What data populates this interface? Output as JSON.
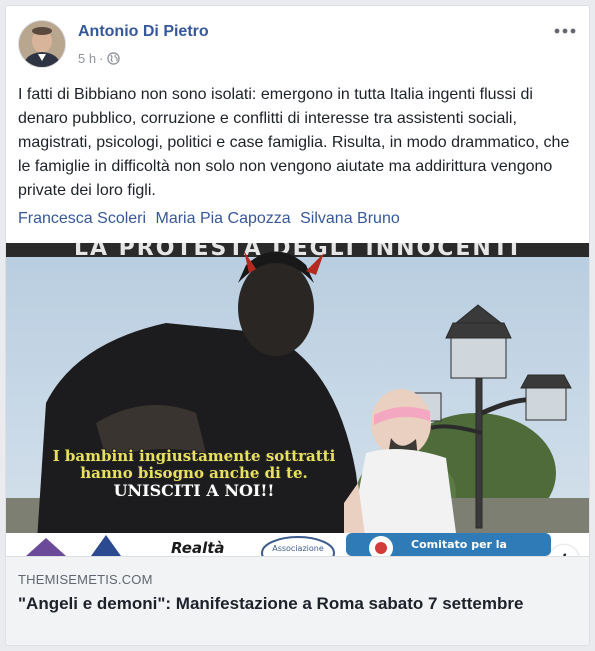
{
  "post": {
    "author": "Antonio Di Pietro",
    "time": "5 h",
    "privacy_icon": "globe-icon",
    "more_icon": "more-options-icon",
    "text": "I fatti di Bibbiano non sono isolati: emergono in tutta Italia ingenti flussi di denaro pubblico, corruzione e conflitti di interesse tra assistenti sociali, magistrati, psicologi, politici e case famiglia. Risulta, in modo drammatico, che le famiglie in difficoltà non solo non vengono aiutate ma addirittura vengono private dei loro figli.",
    "tags": [
      "Francesca Scoleri",
      "Maria Pia Capozza",
      "Silvana Bruno"
    ]
  },
  "image": {
    "banner_top": "LA PROTESTA DEGLI INNOCENTI",
    "caption_line1": "I bambini ingiustamente sottratti",
    "caption_line2": "hanno bisogno anche di te.",
    "caption_line3": "UNISCITI A NOI!!",
    "logo_text_1": "Realtà",
    "logo_text_2": "Associazione",
    "logo_text_3": "Comitato per la",
    "info_label": "i"
  },
  "link": {
    "domain": "THEMISEMETIS.COM",
    "title": "\"Angeli e demoni\": Manifestazione a Roma sabato 7 settembre"
  },
  "colors": {
    "link_blue": "#365899",
    "text": "#1d2129",
    "meta_gray": "#90949c",
    "card_bg": "#ffffff",
    "page_bg": "#e9ebee"
  }
}
